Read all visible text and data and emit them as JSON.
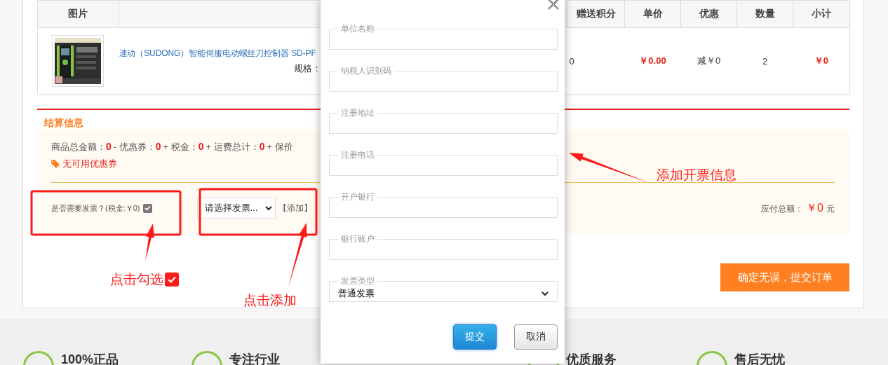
{
  "order_table": {
    "columns": [
      {
        "label": "图片"
      },
      {
        "label": "赠送积分"
      },
      {
        "label": "单价"
      },
      {
        "label": "优惠"
      },
      {
        "label": "数量"
      },
      {
        "label": "小计"
      }
    ],
    "rows": [
      {
        "product_name": "速动（SUDONG）智能伺服电动螺丝刀控制器 SD-PF",
        "spec": "规格：",
        "points": "0",
        "unit_price": "￥0.00",
        "discount": "减￥0",
        "quantity": "2",
        "subtotal": "￥0"
      }
    ]
  },
  "settlement": {
    "title": "结算信息",
    "summary": [
      {
        "label": "商品总金额：",
        "value": "0"
      },
      {
        "label": "- 优惠券：",
        "value": "0"
      },
      {
        "label": "+ 税金：",
        "value": "0"
      },
      {
        "label": "+ 运费总计：",
        "value": "0"
      },
      {
        "label": "+ 保价"
      }
    ],
    "coupon": "无可用优惠券",
    "invoice": {
      "label": "是否需要发票？(税金:￥0)",
      "checked": true,
      "select": "请选择发票...",
      "add_link": "【添加】"
    },
    "total": {
      "label": "应付总额：",
      "amount": "￥0",
      "unit": "元"
    },
    "submit_button": "确定无误，提交订单"
  },
  "features": [
    "100%正品",
    "专注行业",
    "优质服务",
    "售后无忧"
  ],
  "dialog": {
    "fields": [
      {
        "kind": "input",
        "legend": "单位名称"
      },
      {
        "kind": "input",
        "legend": "纳税人识别码"
      },
      {
        "kind": "input",
        "legend": "注册地址"
      },
      {
        "kind": "input",
        "legend": "注册电话"
      },
      {
        "kind": "input",
        "legend": "开户银行"
      },
      {
        "kind": "input",
        "legend": "银行账户"
      },
      {
        "kind": "select",
        "legend": "发票类型",
        "value": "普通发票"
      }
    ],
    "buttons": [
      {
        "label": "提交",
        "primary": true
      },
      {
        "label": "取消",
        "primary": false
      }
    ]
  },
  "annotations": [
    {
      "kind": "check-note",
      "text": "点击勾选"
    },
    {
      "kind": "note",
      "text": "点击添加"
    },
    {
      "kind": "note",
      "text": "添加开票信息"
    }
  ]
}
